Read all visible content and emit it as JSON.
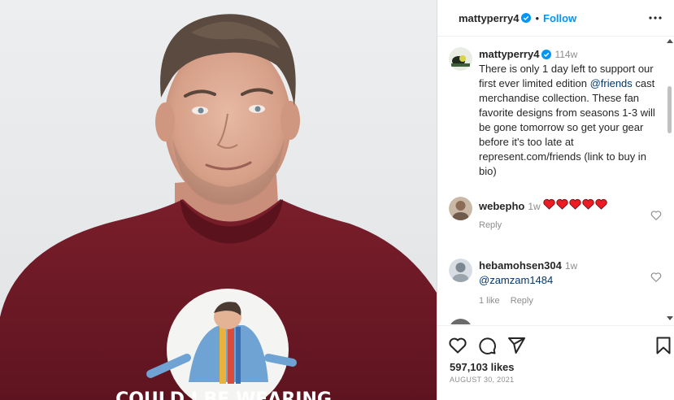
{
  "post": {
    "author": "mattyperry4",
    "follow_label": "Follow",
    "separator": "•",
    "caption": {
      "username": "mattyperry4",
      "time": "114w",
      "text_before": "There is only 1 day left to support our first ever limited edition ",
      "mention": "@friends",
      "text_after": " cast merchandise collection. These fan favorite designs from seasons 1-3 will be gone tomorrow so get your gear before it's too late at represent.com/friends (link to buy in bio)"
    },
    "shirt_text": "COULD I BE WEARING"
  },
  "comments": [
    {
      "username": "webepho",
      "time": "1w",
      "reply_label": "Reply",
      "hearts_count": 5
    },
    {
      "username": "hebamohsen304",
      "time": "1w",
      "mention": "@zamzam1484",
      "likes_label": "1 like",
      "reply_label": "Reply"
    }
  ],
  "footer": {
    "likes": "597,103 likes",
    "date": "AUGUST 30, 2021"
  },
  "icons": {
    "verified": "verified-badge-icon",
    "more": "more-options-icon",
    "like": "heart-icon",
    "comment": "comment-icon",
    "share": "share-icon",
    "save": "bookmark-icon"
  },
  "colors": {
    "accent": "#0095f6",
    "mention": "#00376b",
    "heart_red": "#ed1c24",
    "shirt": "#6d1a26"
  }
}
